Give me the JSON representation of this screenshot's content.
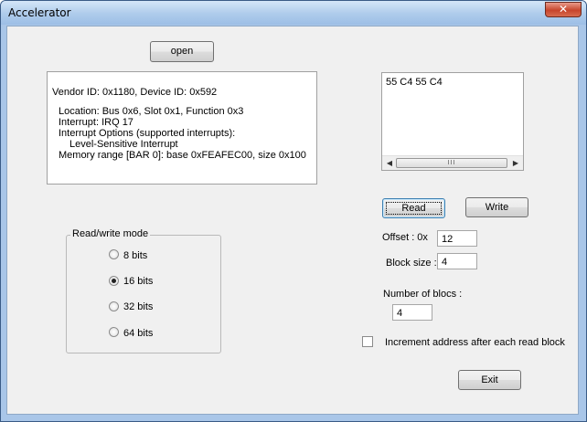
{
  "window": {
    "title": "Accelerator",
    "close_glyph": "✕"
  },
  "buttons": {
    "open": "open",
    "read": "Read",
    "write": "Write",
    "exit": "Exit"
  },
  "device_info": {
    "vendor_line": "Vendor ID: 0x1180, Device ID: 0x592",
    "location": "Location: Bus 0x6, Slot 0x1, Function 0x3",
    "interrupt": "Interrupt: IRQ 17",
    "interrupt_options": "Interrupt Options (supported interrupts):",
    "interrupt_type": "Level-Sensitive Interrupt",
    "memory_range": "Memory range [BAR 0]: base 0xFEAFEC00, size 0x100"
  },
  "data_view": {
    "content": "55 C4 55 C4",
    "scroll_left_glyph": "◀",
    "scroll_right_glyph": "▶",
    "scroll_thumb_grip": "III"
  },
  "mode_group": {
    "label": "Read/write mode",
    "options": [
      {
        "label": "8 bits",
        "selected": false
      },
      {
        "label": "16 bits",
        "selected": true
      },
      {
        "label": "32 bits",
        "selected": false
      },
      {
        "label": "64 bits",
        "selected": false
      }
    ]
  },
  "offset": {
    "label": "Offset :  0x",
    "value": "12"
  },
  "block_size": {
    "label": "Block size :",
    "value": "4"
  },
  "number_of_blocs": {
    "label": "Number of blocs :",
    "value": "4"
  },
  "increment_checkbox": {
    "label": "Increment address after each read block",
    "checked": false
  }
}
